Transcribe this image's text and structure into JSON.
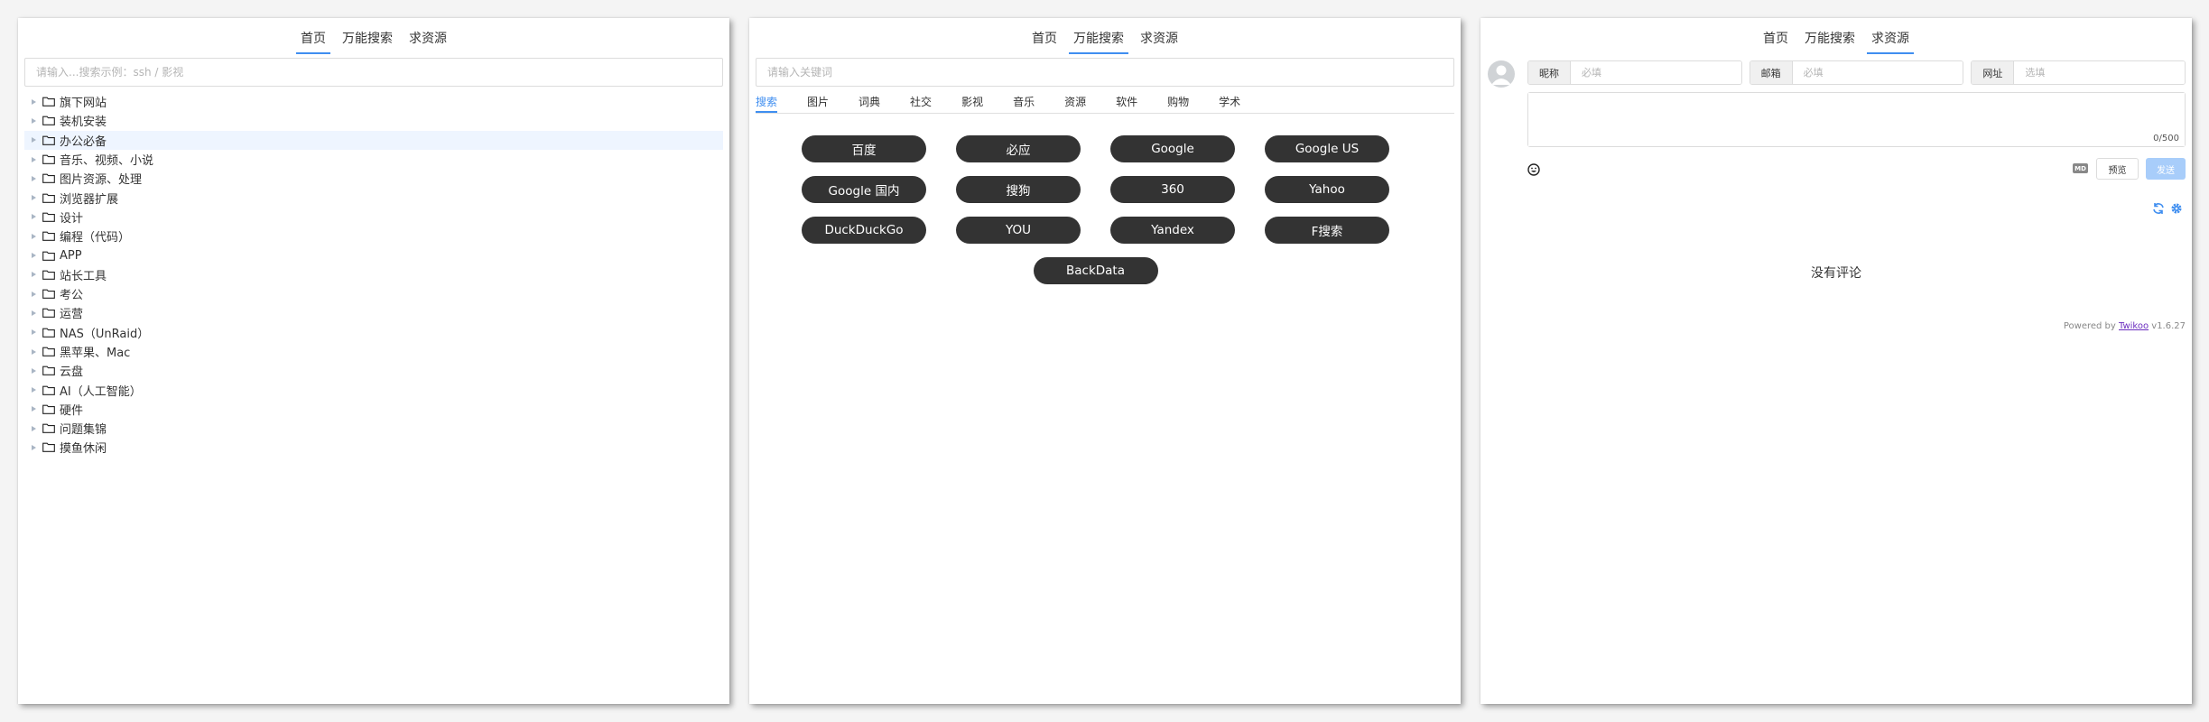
{
  "nav": {
    "home": "首页",
    "search": "万能搜索",
    "request": "求资源"
  },
  "panel1": {
    "search_placeholder": "请输入...搜索示例：ssh / 影视",
    "tree": [
      "旗下网站",
      "装机安装",
      "办公必备",
      "音乐、视频、小说",
      "图片资源、处理",
      "浏览器扩展",
      "设计",
      "编程（代码）",
      "APP",
      "站长工具",
      "考公",
      "运营",
      "NAS（UnRaid）",
      "黑苹果、Mac",
      "云盘",
      "AI（人工智能）",
      "硬件",
      "问题集锦",
      "摸鱼休闲"
    ],
    "highlighted_index": 2
  },
  "panel2": {
    "search_placeholder": "请输入关键词",
    "tabs": [
      "搜索",
      "图片",
      "词典",
      "社交",
      "影视",
      "音乐",
      "资源",
      "软件",
      "购物",
      "学术"
    ],
    "active_tab": 0,
    "engines": [
      "百度",
      "必应",
      "Google",
      "Google US",
      "Google 国内",
      "搜狗",
      "360",
      "Yahoo",
      "DuckDuckGo",
      "YOU",
      "Yandex",
      "F搜索",
      "BackData"
    ]
  },
  "panel3": {
    "nick_label": "昵称",
    "nick_placeholder": "必填",
    "mail_label": "邮箱",
    "mail_placeholder": "必填",
    "url_label": "网址",
    "url_placeholder": "选填",
    "counter": "0/500",
    "md_badge": "MD",
    "preview_label": "预览",
    "send_label": "发送",
    "no_comment": "没有评论",
    "powered_prefix": "Powered by ",
    "powered_link": "Twikoo",
    "powered_version": " v1.6.27"
  },
  "colors": {
    "accent": "#3f8ef0",
    "button_dark": "#333333",
    "send_disabled": "#a8cdfa",
    "highlight": "#eef5ff"
  },
  "icons": {
    "folder": "folder-icon",
    "caret": "caret-right-icon",
    "avatar": "avatar-icon",
    "emoji": "emoji-icon",
    "refresh": "refresh-icon",
    "settings": "gear-icon"
  }
}
